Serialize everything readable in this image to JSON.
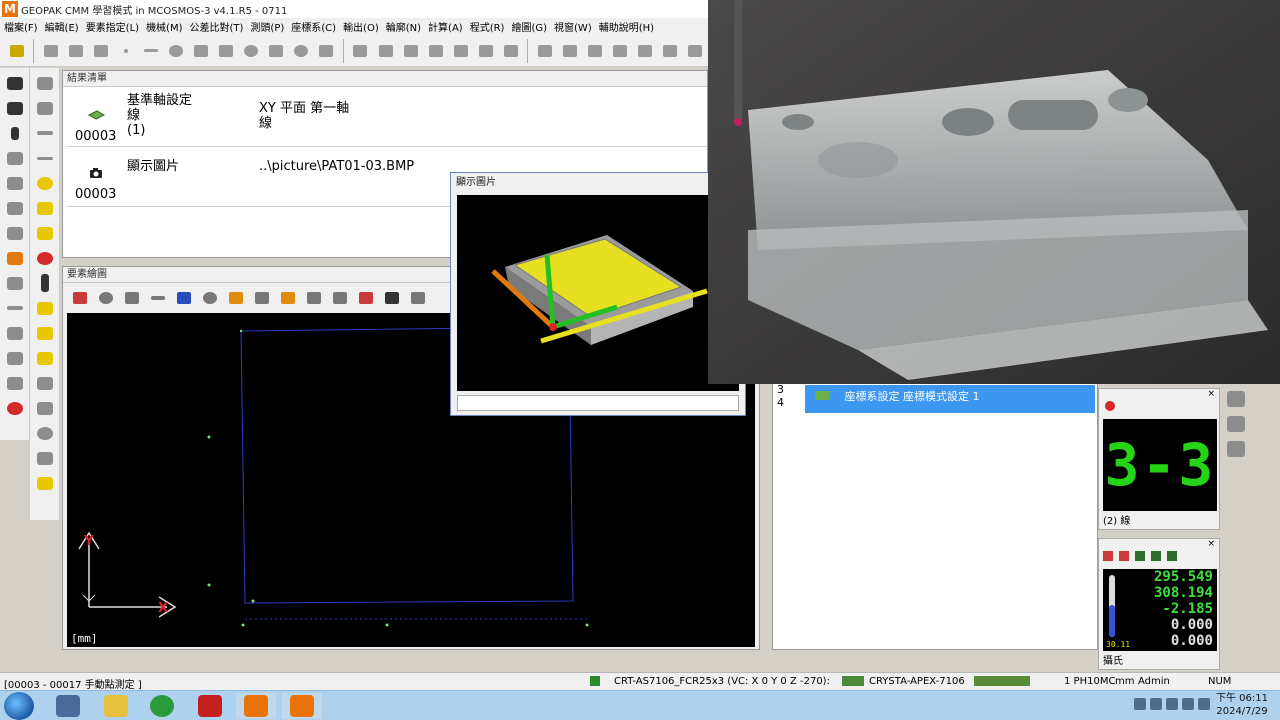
{
  "app": {
    "logo_letter": "M",
    "title": "GEOPAK CMM 學習模式 in MCOSMOS-3 v4.1.R5   - 0711"
  },
  "menu": [
    "檔案(F)",
    "編輯(E)",
    "要素指定(L)",
    "機械(M)",
    "公差比對(T)",
    "測頭(P)",
    "座標系(C)",
    "輸出(O)",
    "輪廓(N)",
    "計算(A)",
    "程式(R)",
    "繪圖(G)",
    "視窗(W)",
    "輔助說明(H)"
  ],
  "results_panel": {
    "caption": "結果清單",
    "rows": [
      {
        "num": "00003",
        "icon": "plane-icon",
        "name": "基準軸設定\n線\n(1)",
        "value": "XY 平面 第一軸\n線"
      },
      {
        "num": "00003",
        "icon": "camera-icon",
        "name": "顯示圖片",
        "value": "..\\picture\\PAT01-03.BMP"
      }
    ]
  },
  "graph_panel": {
    "caption": "要素繪圖",
    "units": "[mm]",
    "axis_x": "X",
    "axis_y": "Y"
  },
  "image_window": {
    "caption": "顯示圖片"
  },
  "program_list": {
    "rows": [
      "3",
      "4"
    ],
    "selected_text": "座標系設定   座標模式設定 1"
  },
  "counter_panel": {
    "display": "3-3",
    "label": "(2) 線"
  },
  "coord_panel": {
    "values": [
      "295.549",
      "308.194",
      "-2.185",
      "0.000",
      "0.000"
    ],
    "temp": "30.11",
    "label": "攝氏"
  },
  "status_bar": {
    "left": "[00003 - 00017 手動點測定 ]",
    "probe": "CRT-AS7106_FCR25x3 (VC: X 0 Y 0 Z -270):",
    "machine": "CRYSTA-APEX-7106",
    "probe_count": "1 PH10MC",
    "unit": "mm",
    "user": "Admin",
    "num": "NUM"
  },
  "taskbar": {
    "time": "下午 06:11",
    "date": "2024/7/29"
  },
  "colors": {
    "accent_orange": "#e8720c",
    "selection_blue": "#3d96f0",
    "lcd_green": "#26d417"
  }
}
